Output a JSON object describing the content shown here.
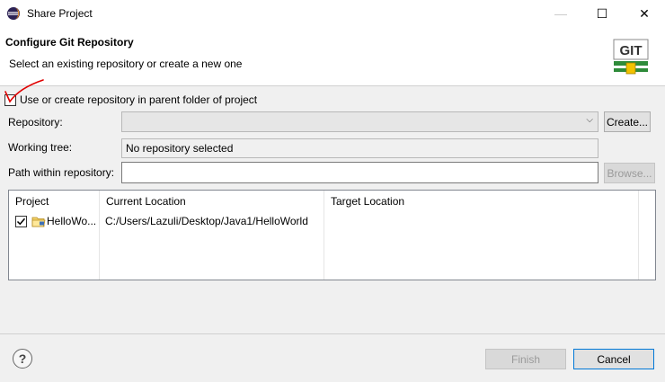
{
  "window": {
    "title": "Share Project",
    "controls": {
      "minimize": "—",
      "maximize": "☐",
      "close": "✕"
    }
  },
  "header": {
    "title": "Configure Git Repository",
    "description": "Select an existing repository or create a new one",
    "logo_text": "GIT"
  },
  "options": {
    "use_parent_label": "Use or create repository in parent folder of project",
    "use_parent_checked": false
  },
  "form": {
    "repository_label": "Repository:",
    "repository_value": "",
    "create_button": "Create...",
    "working_tree_label": "Working tree:",
    "working_tree_value": "No repository selected",
    "path_label": "Path within repository:",
    "path_value": "",
    "browse_button": "Browse..."
  },
  "table": {
    "columns": [
      "Project",
      "Current Location",
      "Target Location"
    ],
    "rows": [
      {
        "project": "HelloWo...",
        "current_location": "C:/Users/Lazuli/Desktop/Java1/HelloWorld",
        "target_location": "",
        "checked": true
      }
    ]
  },
  "footer": {
    "help": "?",
    "finish_button": "Finish",
    "cancel_button": "Cancel"
  },
  "colors": {
    "window_bg": "#f0f0f0",
    "header_bg": "#ffffff",
    "annotation_red": "#e00000",
    "git_logo_green": "#2e8b3a",
    "git_logo_yellow": "#f2c200"
  }
}
